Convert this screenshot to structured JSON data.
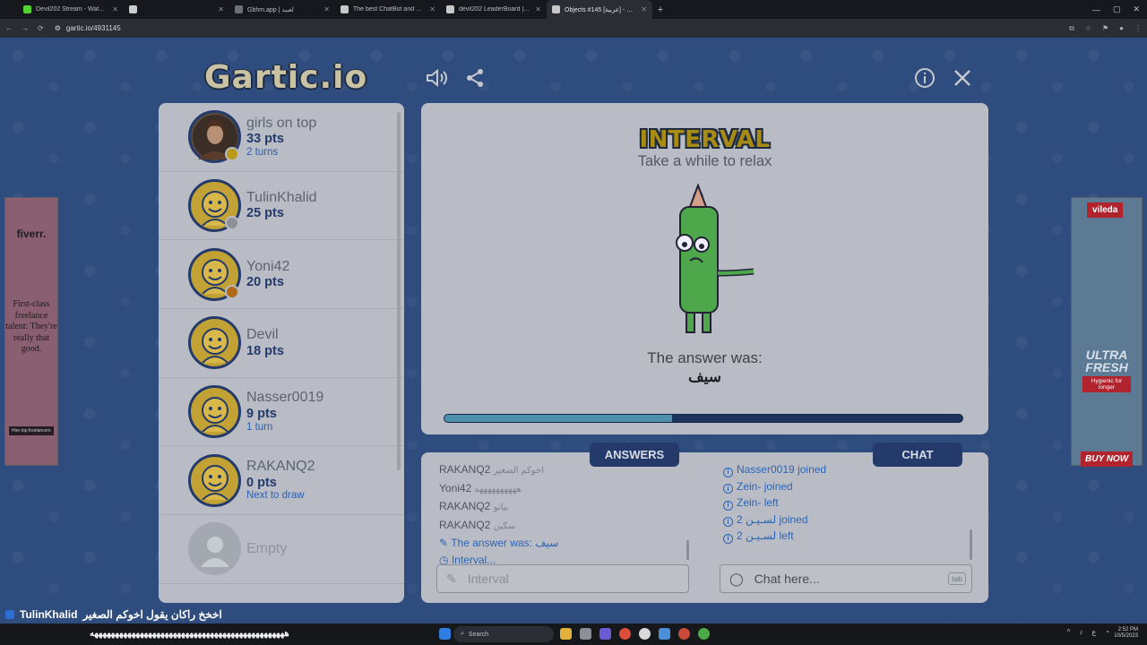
{
  "browser": {
    "tabs": [
      {
        "title": "Devil202 Stream - Watch Live o",
        "color": "#53d12f",
        "active": false
      },
      {
        "title": "",
        "color": "#cccccc",
        "active": false
      },
      {
        "title": "Gbhm.app | لعبيد",
        "color": "#6a6f78",
        "active": false
      },
      {
        "title": "The best ChatBot and Widg",
        "color": "#c8c8c8",
        "active": false
      },
      {
        "title": "devil202 LeaderBoard | The be",
        "color": "#c8c8c8",
        "active": false
      },
      {
        "title": "Objects #145 [عربية] - Gartic.io",
        "color": "#c8c8c8",
        "active": true
      }
    ],
    "url": "gartic.io/4931145"
  },
  "game": {
    "logo": "Gartic.io",
    "players": [
      {
        "name": "girls on top",
        "pts": "33 pts",
        "sub": "2 turns",
        "badge": "#b99a1a",
        "kind": "photo"
      },
      {
        "name": "TulinKhalid",
        "pts": "25 pts",
        "sub": "",
        "badge": "#8e9196",
        "kind": "default"
      },
      {
        "name": "Yoni42",
        "pts": "20 pts",
        "sub": "",
        "badge": "#b06a1a",
        "kind": "default"
      },
      {
        "name": "Devil",
        "pts": "18 pts",
        "sub": "",
        "badge": "",
        "kind": "default"
      },
      {
        "name": "Nasser0019",
        "pts": "9 pts",
        "sub": "1 turn",
        "badge": "",
        "kind": "default"
      },
      {
        "name": "RAKANQ2",
        "pts": "0 pts",
        "sub": "Next to draw",
        "badge": "",
        "kind": "default"
      },
      {
        "name": "Empty",
        "pts": "",
        "sub": "",
        "badge": "",
        "kind": "empty"
      }
    ],
    "stage": {
      "title": "INTERVAL",
      "subtitle": "Take a while to relax",
      "answer_label": "The answer was:",
      "answer": "سيف",
      "progress": 0.44
    },
    "answers_tab": "ANSWERS",
    "chat_tab": "CHAT",
    "answers_feed": [
      {
        "user": "RAKANQ2",
        "guess": "اخوكم الصغير",
        "type": "guess"
      },
      {
        "user": "Yoni42",
        "guess": "ههههههههههه",
        "type": "guess"
      },
      {
        "user": "RAKANQ2",
        "guess": "بيانو",
        "type": "guess"
      },
      {
        "user": "RAKANQ2",
        "guess": "سكين",
        "type": "guess"
      },
      {
        "user": "The answer was:",
        "guess": "سيف",
        "type": "answer"
      },
      {
        "user": "Interval...",
        "guess": "",
        "type": "interval"
      }
    ],
    "answer_input_placeholder": "Interval",
    "chat_feed": [
      {
        "user": "Nasser0019",
        "action": "joined"
      },
      {
        "user": "Zein-",
        "action": "joined"
      },
      {
        "user": "Zein-",
        "action": "left"
      },
      {
        "user": "2 لسـيـن",
        "action": "joined"
      },
      {
        "user": "2 لسـيـن",
        "action": "left"
      }
    ],
    "chat_input_placeholder": "Chat here...",
    "tab_key": "tab"
  },
  "ads": {
    "left": {
      "brand": "fiverr.",
      "text": "First-class freelance talent: They're really that good.",
      "cta": "Hire top freelancers"
    },
    "right": {
      "brand": "vileda",
      "headline": "ULTRA FRESH",
      "tag": "Hygienic for longer",
      "cta": "BUY NOW"
    }
  },
  "stream": {
    "user": "TulinKhalid",
    "message": "اخخخ راكان يقول اخوكم الصغير",
    "spam": "هههههههههههههههههههههههههههههههههههههههههههههههه"
  },
  "taskbar": {
    "search": "Search",
    "time": "2:52 PM",
    "date": "10/5/2023"
  }
}
